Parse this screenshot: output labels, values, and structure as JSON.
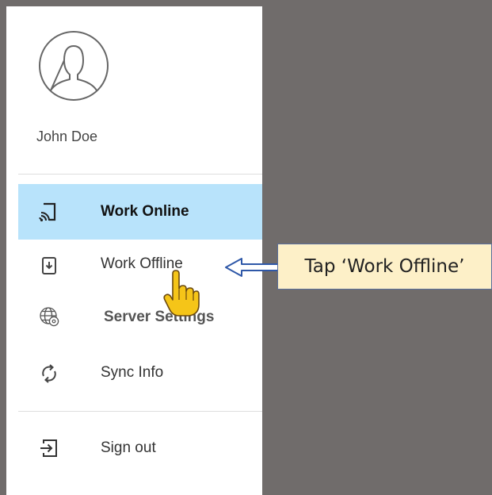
{
  "user": {
    "name": "John Doe",
    "avatar_icon": "user-avatar-icon"
  },
  "menu": {
    "items": [
      {
        "label": "Work Online",
        "icon": "cast-device-icon",
        "active": true
      },
      {
        "label": "Work Offline",
        "icon": "device-download-icon",
        "active": false
      },
      {
        "label": "Server Settings",
        "icon": "globe-gear-icon",
        "active": false
      },
      {
        "label": "Sync Info",
        "icon": "sync-icon",
        "active": false
      },
      {
        "label": "Sign out",
        "icon": "sign-out-icon",
        "active": false
      }
    ]
  },
  "callout": {
    "text": "Tap ‘Work Offline’",
    "pointer_icon": "pointing-hand-icon"
  },
  "colors": {
    "background": "#706c6b",
    "active_item": "#b8e3fb",
    "callout_fill": "#fdf0c8",
    "callout_border": "#5a6f9c",
    "hand_fill": "#f5c518"
  }
}
